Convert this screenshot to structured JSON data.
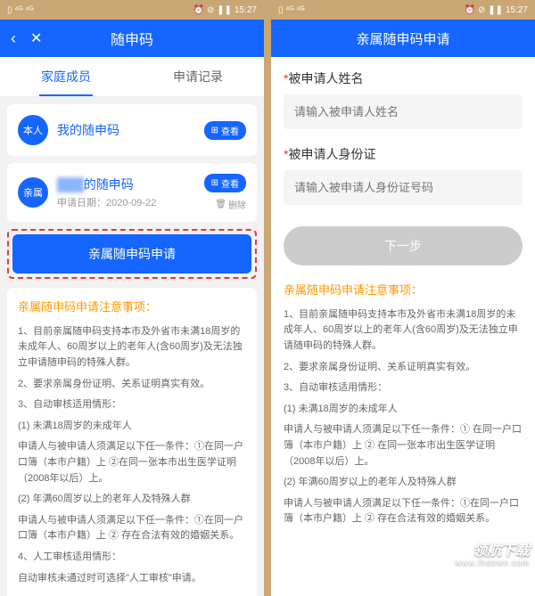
{
  "status": {
    "time": "15:27",
    "indicators": "⏰ ⊘ ❚❚"
  },
  "left": {
    "nav_title": "随申码",
    "tabs": {
      "family": "家庭成员",
      "records": "申请记录"
    },
    "self": {
      "badge": "本人",
      "title": "我的随申码",
      "view": "查看",
      "qr_icon": "⊞"
    },
    "relative": {
      "badge": "亲属",
      "title_suffix": "的随申码",
      "date_label": "申请日期：",
      "date": "2020-09-22",
      "view": "查看",
      "delete": "删除",
      "trash_icon": "🗑"
    },
    "apply_btn": "亲属随申码申请"
  },
  "right": {
    "nav_title": "亲属随申码申请",
    "name_label": "被申请人姓名",
    "name_placeholder": "请输入被申请人姓名",
    "id_label": "被申请人身份证",
    "id_placeholder": "请输入被申请人身份证号码",
    "next": "下一步"
  },
  "notice": {
    "title": "亲属随申码申请注意事项：",
    "items": [
      "1、目前亲属随申码支持本市及外省市未满18周岁的未成年人、60周岁以上的老年人(含60周岁)及无法独立申请随申码的特殊人群。",
      "2、要求亲属身份证明、关系证明真实有效。",
      "3、自动审核适用情形：",
      "(1) 未满18周岁的未成年人",
      "申请人与被申请人须满足以下任一条件：①在同一户口簿（本市户籍）上  ②在同一张本市出生医学证明（2008年以后）上。",
      "(2) 年满60周岁以上的老年人及特殊人群",
      "申请人与被申请人须满足以下任一条件：①在同一户口簿（本市户籍）上  ② 存在合法有效的婚姻关系。",
      "4、人工审核适用情形：",
      "自动审核未通过时可选择\"人工审核\"申请。"
    ]
  },
  "notice_right": {
    "items": [
      "1、目前亲属随申码支持本市及外省市未满18周岁的未成年人、60周岁以上的老年人(含60周岁)及无法独立申请随申码的特殊人群。",
      "2、要求亲属身份证明、关系证明真实有效。",
      "3、自动审核适用情形：",
      "(1) 未满18周岁的未成年人",
      "申请人与被申请人须满足以下任一条件：① 在同一户口簿（本市户籍）上  ② 在同一张本市出生医学证明（2008年以后）上。",
      "(2) 年满60周岁以上的老年人及特殊人群",
      "申请人与被申请人须满足以下任一条件：①在同一户口簿（本市户籍）上  ② 存在合法有效的婚姻关系。"
    ]
  },
  "watermark": {
    "main": "领航下载",
    "sub": "www.lhdown.com"
  }
}
